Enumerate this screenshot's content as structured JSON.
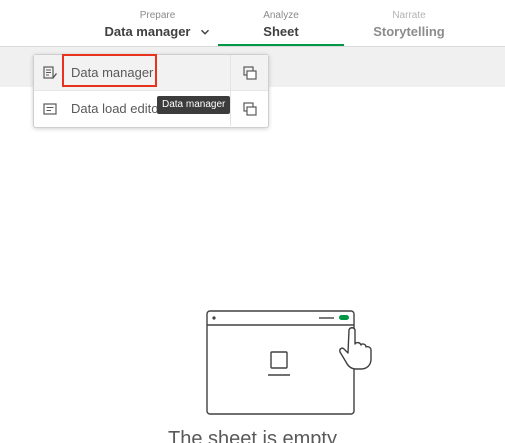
{
  "nav": {
    "prepare": {
      "sub": "Prepare",
      "main": "Data manager"
    },
    "analyze": {
      "sub": "Analyze",
      "main": "Sheet"
    },
    "narrate": {
      "sub": "Narrate",
      "main": "Storytelling"
    }
  },
  "menu": {
    "items": [
      {
        "label": "Data manager",
        "icon": "data-manager-icon",
        "action_icon": "open-new-tab-icon"
      },
      {
        "label": "Data load edito",
        "icon": "data-load-editor-icon",
        "action_icon": "open-new-tab-icon"
      }
    ]
  },
  "tooltip": {
    "text": "Data manager"
  },
  "empty_sheet": {
    "title": "The sheet is empty"
  },
  "colors": {
    "accent_green": "#009845",
    "highlight_red": "#e8321e",
    "tooltip_bg": "#3c3c3c",
    "band_gray": "#f0f0f0"
  }
}
